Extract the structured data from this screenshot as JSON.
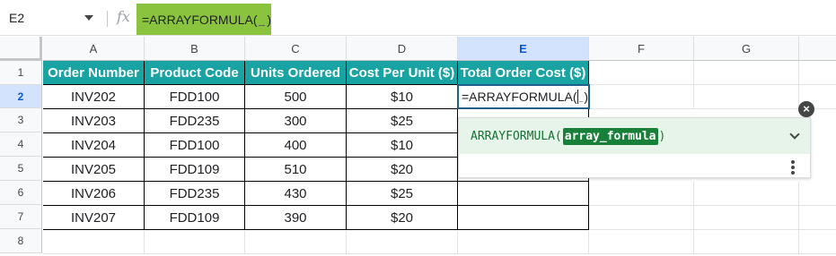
{
  "formula_bar": {
    "name_box": "E2",
    "fx_label": "fx",
    "formula_prefix": "=ARRAYFORMULA(",
    "formula_suffix": ")"
  },
  "columns": [
    "A",
    "B",
    "C",
    "D",
    "E",
    "F",
    "G"
  ],
  "rows": [
    "1",
    "2",
    "3",
    "4",
    "5",
    "6",
    "7",
    "8"
  ],
  "table": {
    "headers": [
      "Order Number",
      "Product Code",
      "Units Ordered",
      "Cost Per Unit ($)",
      "Total Order Cost ($)"
    ],
    "body": [
      [
        "INV202",
        "FDD100",
        "500",
        "$10"
      ],
      [
        "INV203",
        "FDD235",
        "300",
        "$25"
      ],
      [
        "INV204",
        "FDD100",
        "400",
        "$10"
      ],
      [
        "INV205",
        "FDD109",
        "510",
        "$20"
      ],
      [
        "INV206",
        "FDD235",
        "430",
        "$25"
      ],
      [
        "INV207",
        "FDD109",
        "390",
        "$20"
      ]
    ]
  },
  "active_cell": {
    "prefix": "=ARRAYFORMULA(",
    "suffix": ")"
  },
  "formula_help": {
    "function_name": "ARRAYFORMULA(",
    "argument": "array_formula",
    "closing": ")",
    "close_icon": "close-icon",
    "expand_icon": "chevron-down-icon",
    "more_icon": "more-vert-icon"
  },
  "colors": {
    "header_fill": "#1aa3a3",
    "formula_highlight": "#8ac43f",
    "selection": "#d3e3fd",
    "help_bg": "#e6f4ea",
    "help_arg": "#188038"
  }
}
